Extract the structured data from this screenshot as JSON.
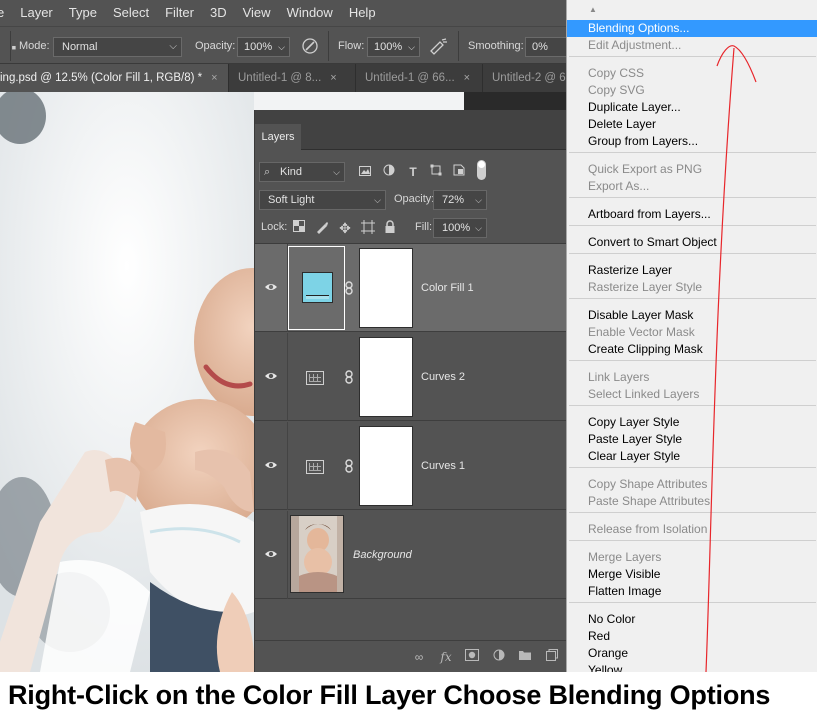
{
  "menubar": {
    "items": [
      "e",
      "Layer",
      "Type",
      "Select",
      "Filter",
      "3D",
      "View",
      "Window",
      "Help"
    ]
  },
  "options": {
    "mode_label": "Mode:",
    "mode_value": "Normal",
    "opacity_label": "Opacity:",
    "opacity_value": "100%",
    "flow_label": "Flow:",
    "flow_value": "100%",
    "smoothing_label": "Smoothing:",
    "smoothing_value": "0%"
  },
  "tabs": [
    {
      "label": "ing.psd @ 12.5% (Color Fill 1, RGB/8) *",
      "close": "×"
    },
    {
      "label": "Untitled-1 @ 8...",
      "close": "×"
    },
    {
      "label": "Untitled-1 @ 66...",
      "close": "×"
    },
    {
      "label": "Untitled-2 @ 6",
      "close": ""
    }
  ],
  "layers_panel": {
    "tab_label": "Layers",
    "filter_kind": "Kind",
    "blend_mode": "Soft Light",
    "opacity_label": "Opacity:",
    "opacity_value": "72%",
    "lock_label": "Lock:",
    "fill_label": "Fill:",
    "fill_value": "100%",
    "layers": [
      {
        "name": "Color Fill 1",
        "selected": true
      },
      {
        "name": "Curves 2",
        "selected": false
      },
      {
        "name": "Curves 1",
        "selected": false
      },
      {
        "name": "Background",
        "selected": false
      }
    ]
  },
  "context_menu": {
    "items": [
      {
        "label": "Blending Options...",
        "state": "highlighted"
      },
      {
        "label": "Edit Adjustment...",
        "state": "disabled"
      },
      {
        "label": "Copy CSS",
        "state": "disabled"
      },
      {
        "label": "Copy SVG",
        "state": "disabled"
      },
      {
        "label": "Duplicate Layer...",
        "state": "enabled"
      },
      {
        "label": "Delete Layer",
        "state": "enabled"
      },
      {
        "label": "Group from Layers...",
        "state": "enabled"
      },
      {
        "label": "Quick Export as PNG",
        "state": "disabled"
      },
      {
        "label": "Export As...",
        "state": "disabled"
      },
      {
        "label": "Artboard from Layers...",
        "state": "enabled"
      },
      {
        "label": "Convert to Smart Object",
        "state": "enabled"
      },
      {
        "label": "Rasterize Layer",
        "state": "enabled"
      },
      {
        "label": "Rasterize Layer Style",
        "state": "disabled"
      },
      {
        "label": "Disable Layer Mask",
        "state": "enabled"
      },
      {
        "label": "Enable Vector Mask",
        "state": "disabled"
      },
      {
        "label": "Create Clipping Mask",
        "state": "enabled"
      },
      {
        "label": "Link Layers",
        "state": "disabled"
      },
      {
        "label": "Select Linked Layers",
        "state": "disabled"
      },
      {
        "label": "Copy Layer Style",
        "state": "enabled"
      },
      {
        "label": "Paste Layer Style",
        "state": "enabled"
      },
      {
        "label": "Clear Layer Style",
        "state": "enabled"
      },
      {
        "label": "Copy Shape Attributes",
        "state": "disabled"
      },
      {
        "label": "Paste Shape Attributes",
        "state": "disabled"
      },
      {
        "label": "Release from Isolation",
        "state": "disabled"
      },
      {
        "label": "Merge Layers",
        "state": "disabled"
      },
      {
        "label": "Merge Visible",
        "state": "enabled"
      },
      {
        "label": "Flatten Image",
        "state": "enabled"
      },
      {
        "label": "No Color",
        "state": "enabled"
      },
      {
        "label": "Red",
        "state": "enabled"
      },
      {
        "label": "Orange",
        "state": "enabled"
      },
      {
        "label": "Yellow",
        "state": "enabled"
      }
    ]
  },
  "caption": "Right-Click on the Color Fill Layer Choose Blending Options",
  "colors": {
    "panel_bg": "#535353",
    "selected_layer": "#6b6b6b",
    "menu_highlight": "#3399ff",
    "fill_swatch": "#7dd3e6",
    "annotation": "#e8262b"
  }
}
